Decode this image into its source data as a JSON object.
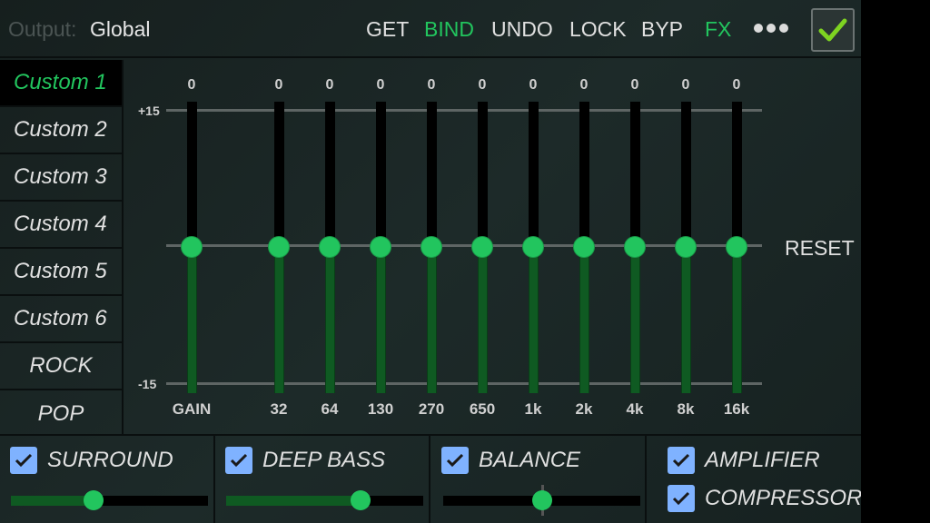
{
  "header": {
    "output_label": "Output:",
    "output_value": "Global",
    "buttons": [
      {
        "label": "GET",
        "active": false
      },
      {
        "label": "BIND",
        "active": true
      },
      {
        "label": "UNDO",
        "active": false
      },
      {
        "label": "LOCK",
        "active": false
      },
      {
        "label": "BYP",
        "active": false
      },
      {
        "label": "FX",
        "active": true
      }
    ],
    "more_icon": "three-dots-icon",
    "apply_icon": "checkmark-icon"
  },
  "presets": [
    {
      "label": "Custom 1",
      "selected": true
    },
    {
      "label": "Custom 2",
      "selected": false
    },
    {
      "label": "Custom 3",
      "selected": false
    },
    {
      "label": "Custom 4",
      "selected": false
    },
    {
      "label": "Custom 5",
      "selected": false
    },
    {
      "label": "Custom 6",
      "selected": false
    },
    {
      "label": "ROCK",
      "selected": false
    },
    {
      "label": "POP",
      "selected": false
    }
  ],
  "eq": {
    "scale_max_label": "+15",
    "scale_min_label": "-15",
    "range_db": [
      -15,
      15
    ],
    "bands": [
      {
        "label": "GAIN",
        "value": 0
      },
      {
        "label": "32",
        "value": 0
      },
      {
        "label": "64",
        "value": 0
      },
      {
        "label": "130",
        "value": 0
      },
      {
        "label": "270",
        "value": 0
      },
      {
        "label": "650",
        "value": 0
      },
      {
        "label": "1k",
        "value": 0
      },
      {
        "label": "2k",
        "value": 0
      },
      {
        "label": "4k",
        "value": 0
      },
      {
        "label": "8k",
        "value": 0
      },
      {
        "label": "16k",
        "value": 0
      }
    ],
    "reset_label": "RESET"
  },
  "effects": {
    "surround": {
      "label": "SURROUND",
      "checked": true,
      "level": 0.42
    },
    "deep_bass": {
      "label": "DEEP BASS",
      "checked": true,
      "level": 0.68
    },
    "balance": {
      "label": "BALANCE",
      "checked": true,
      "level": 0.5
    },
    "amplifier": {
      "label": "AMPLIFIER",
      "checked": true
    },
    "compressor": {
      "label": "COMPRESSOR",
      "checked": true
    }
  },
  "colors": {
    "accent": "#22c55e",
    "fill": "#0f5a22",
    "checkbox": "#7fb2ff"
  },
  "navbar": {
    "recents_icon": "square-icon",
    "home_icon": "circle-icon",
    "back_icon": "triangle-back-icon"
  }
}
